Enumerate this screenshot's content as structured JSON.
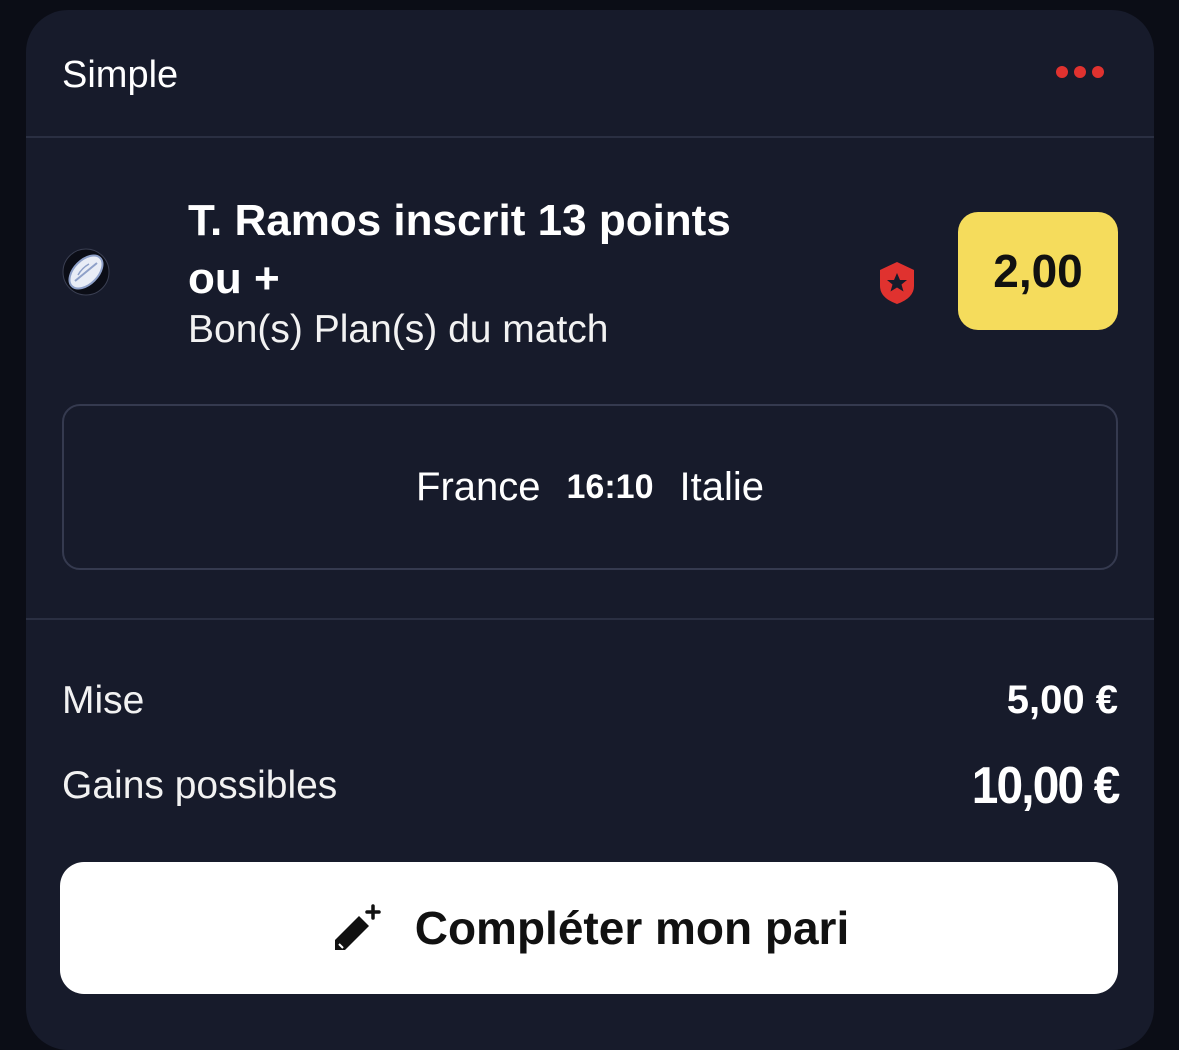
{
  "bet_slip": {
    "type_label": "Simple",
    "more_icon": "more-dots-icon",
    "accent_color": "#e0322f"
  },
  "selection": {
    "sport_icon": "rugby-ball-icon",
    "title": "T. Ramos inscrit 13 points ou +",
    "market": "Bon(s) Plan(s) du match",
    "boost_icon": "boost-shield-star-icon",
    "odds": "2,00",
    "odds_bg_color": "#f5dc5c"
  },
  "match": {
    "home_team": "France",
    "score": "16:10",
    "away_team": "Italie"
  },
  "summary": {
    "stake_label": "Mise",
    "stake_value": "5,00 €",
    "winnings_label": "Gains possibles",
    "winnings_value": "10,00 €"
  },
  "actions": {
    "complete_icon": "pencil-plus-icon",
    "complete_label": "Compléter mon pari"
  }
}
